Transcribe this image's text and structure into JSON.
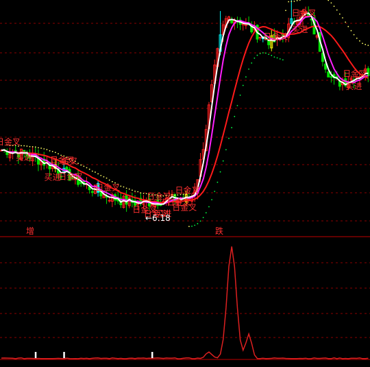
{
  "colors": {
    "background": "#000000",
    "grid": "#8b0000",
    "separator": "#c00000",
    "up_candle": "#ff2020",
    "down_candle": "#00e000",
    "cyan_candle": "#00ffff",
    "yellow_candle": "#ffff00",
    "white_line": "#ffffff",
    "magenta_line": "#ff20ff",
    "red_line": "#ff1a1a",
    "dot_up": "#ffff66",
    "dot_down": "#00ff44",
    "signal_text": "#ff3030",
    "lower_line": "#dd2020",
    "marker": "#ffffff"
  },
  "labels": {
    "zeng": "增",
    "die": "跌",
    "low_price": "←6.18"
  },
  "signals": [
    {
      "text": "日金叉",
      "bar": 0,
      "row": "upper"
    },
    {
      "text": "日金叉",
      "bar": 19,
      "row": "upper"
    },
    {
      "text": "金叉",
      "bar": 23,
      "row": "upper"
    },
    {
      "text": "日金叉",
      "bar": 35,
      "row": "upper"
    },
    {
      "text": "日金叉",
      "bar": 53,
      "row": "upper"
    },
    {
      "text": "日金叉",
      "bar": 63,
      "row": "upper"
    },
    {
      "text": "日金叉",
      "bar": 94,
      "row": "upper"
    },
    {
      "text": "日金叉",
      "bar": 104,
      "row": "upper"
    },
    {
      "text": "日金叉",
      "bar": 122,
      "row": "upper"
    },
    {
      "text": "买进",
      "bar": 7,
      "row": "lower"
    },
    {
      "text": "买进",
      "bar": 17,
      "row": "lower"
    },
    {
      "text": "日金叉",
      "bar": 22,
      "row": "lower"
    },
    {
      "text": "日金叉",
      "bar": 48,
      "row": "lower"
    },
    {
      "text": "日金叉",
      "bar": 52,
      "row": "lower"
    },
    {
      "text": "买进",
      "bar": 56,
      "row": "lower"
    },
    {
      "text": "日金叉",
      "bar": 60,
      "row": "lower"
    },
    {
      "text": "日金叉",
      "bar": 62,
      "row": "lower"
    },
    {
      "text": "买进",
      "bar": 104,
      "row": "lower"
    },
    {
      "text": "买进",
      "bar": 123,
      "row": "lower"
    }
  ],
  "chart_data": {
    "type": "candlestick",
    "bars": 130,
    "price": {
      "low": 6.18,
      "low_label_bar": 50,
      "segments": [
        {
          "from_bar": 0,
          "to_bar": 48,
          "start": 7.55,
          "end": 6.35
        },
        {
          "from_bar": 48,
          "to_bar": 66,
          "start": 6.35,
          "end": 6.45
        },
        {
          "from_bar": 66,
          "to_bar": 80,
          "start": 6.45,
          "end": 10.6
        },
        {
          "from_bar": 80,
          "to_bar": 96,
          "start": 10.6,
          "end": 10.05
        },
        {
          "from_bar": 96,
          "to_bar": 106,
          "start": 10.05,
          "end": 10.7
        },
        {
          "from_bar": 106,
          "to_bar": 118,
          "start": 10.7,
          "end": 9.1
        },
        {
          "from_bar": 118,
          "to_bar": 129,
          "start": 9.1,
          "end": 9.35
        }
      ]
    },
    "indicator": {
      "name": "",
      "baseline": 0,
      "peaks": [
        {
          "bar": 81,
          "value": 100
        },
        {
          "bar": 87,
          "value": 22
        },
        {
          "bar": 73,
          "value": 6
        }
      ],
      "markers_bars": [
        12,
        22,
        53
      ]
    }
  }
}
